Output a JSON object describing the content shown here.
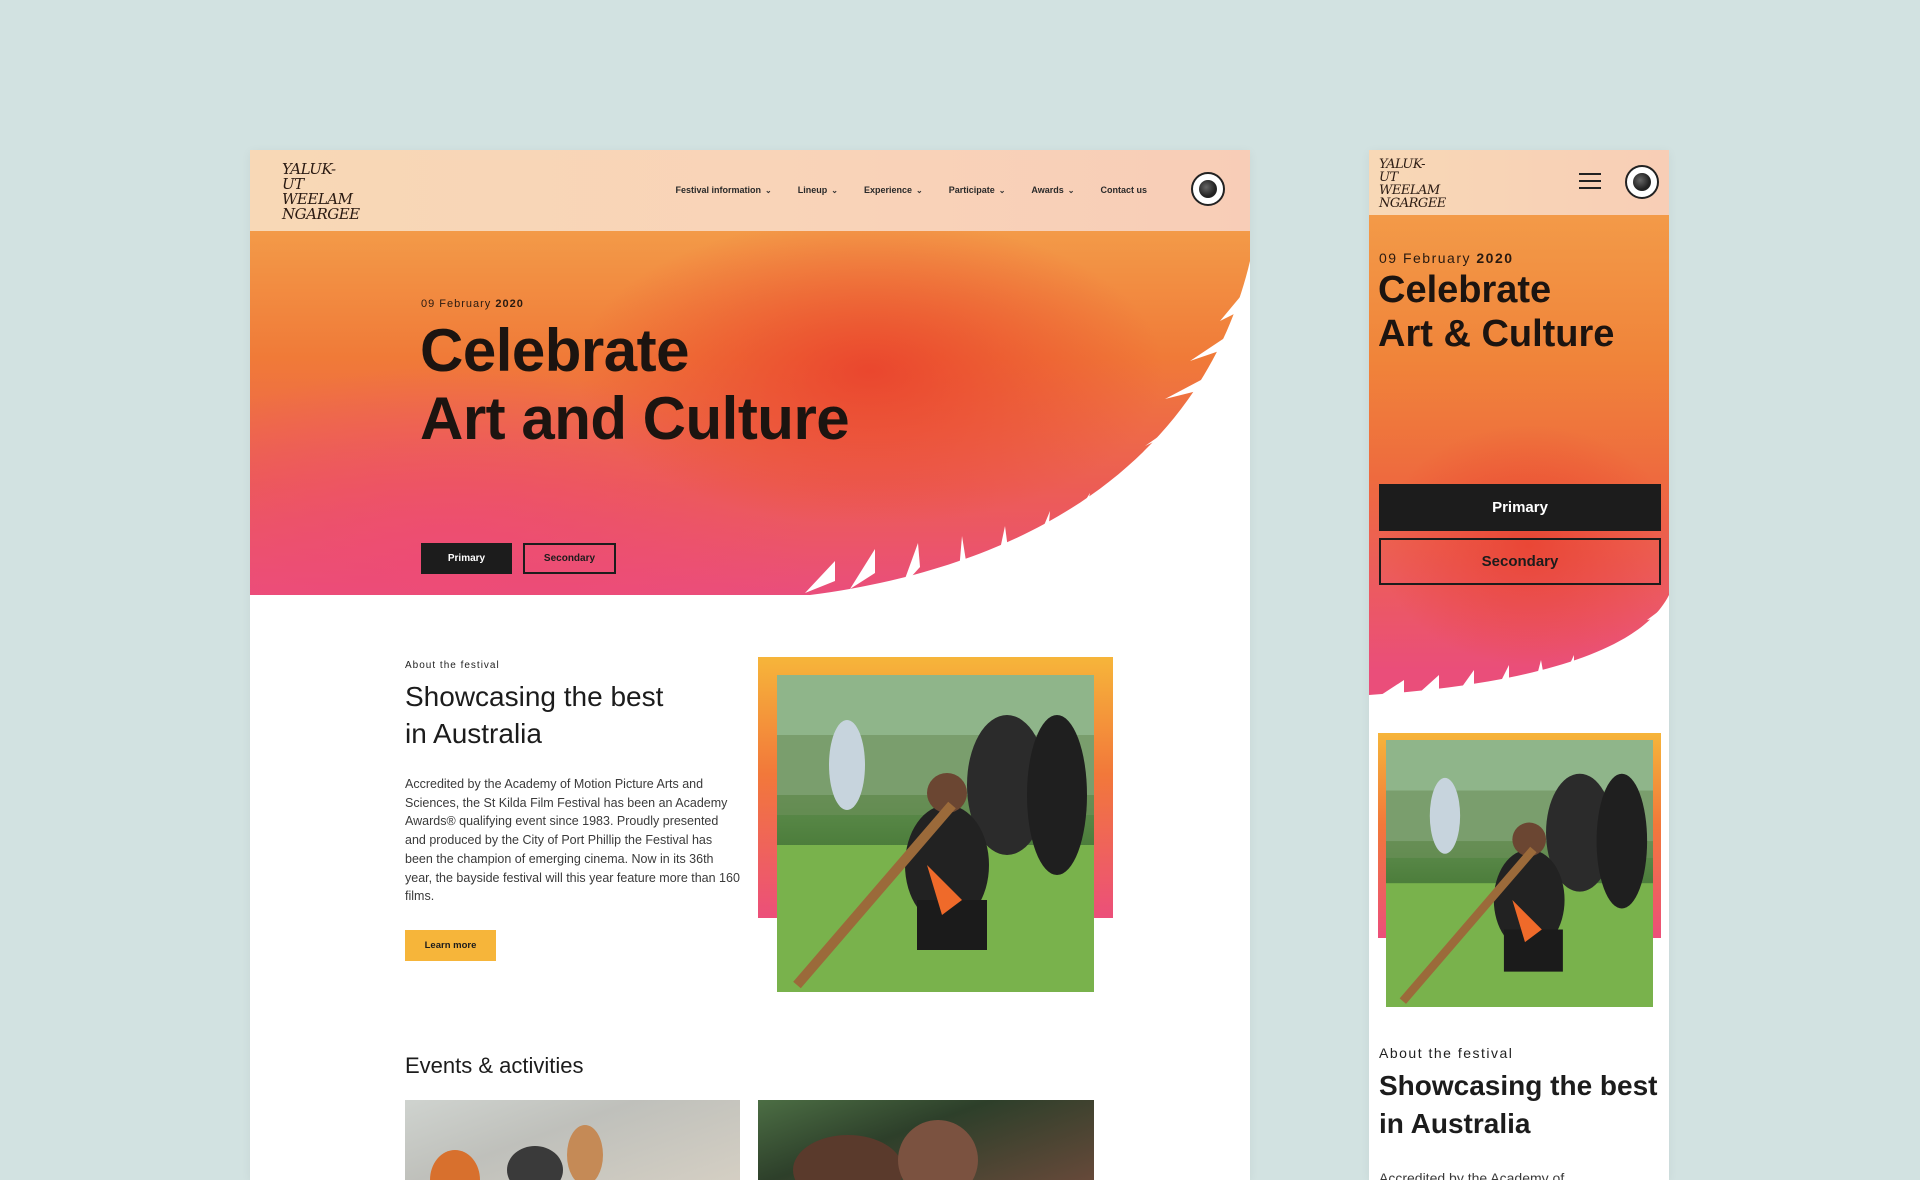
{
  "logo_text": [
    "YALUK-UT",
    "WEELAM",
    "NGARGEE"
  ],
  "nav": {
    "items": [
      {
        "label": "Festival information",
        "dropdown": true
      },
      {
        "label": "Lineup",
        "dropdown": true
      },
      {
        "label": "Experience",
        "dropdown": true
      },
      {
        "label": "Participate",
        "dropdown": true
      },
      {
        "label": "Awards",
        "dropdown": true
      },
      {
        "label": "Contact us",
        "dropdown": false
      }
    ]
  },
  "desktop": {
    "hero": {
      "date_day": "09 February",
      "date_year": "2020",
      "title_line1": "Celebrate",
      "title_line2": "Art and Culture",
      "primary_label": "Primary",
      "secondary_label": "Secondary"
    },
    "about": {
      "kicker": "About the festival",
      "title_line1": "Showcasing the best",
      "title_line2": "in Australia",
      "body": "Accredited by the Academy of Motion Picture Arts and Sciences, the St Kilda Film Festival has been an Academy Awards® qualifying event since 1983. Proudly presented and produced by the City of Port Phillip the Festival has been the champion of emerging cinema. Now in its 36th year, the bayside festival will this year feature more than 160 films.",
      "learn_more_label": "Learn more"
    },
    "events_title": "Events & activities"
  },
  "mobile": {
    "hero": {
      "date_day": "09 February",
      "date_year": "2020",
      "title_line1": "Celebrate",
      "title_line2": "Art & Culture",
      "primary_label": "Primary",
      "secondary_label": "Secondary"
    },
    "about": {
      "kicker": "About the festival",
      "title_line1": "Showcasing the best",
      "title_line2": "in Australia",
      "body_partial": "Accredited by the Academy of"
    }
  },
  "colors": {
    "background": "#d2e2e1",
    "nav_peach": "#f8d8b6",
    "hero_orange": "#f07a38",
    "hero_pink": "#ea4e7c",
    "accent_yellow": "#f6b53a",
    "dark": "#1c1c1c"
  },
  "icons": [
    "chevron-down-icon",
    "hamburger-menu-icon",
    "council-seal-icon"
  ]
}
